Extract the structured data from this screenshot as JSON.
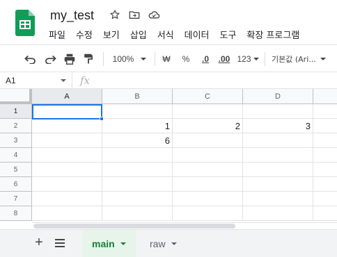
{
  "document": {
    "title": "my_test"
  },
  "menu": [
    "파일",
    "수정",
    "보기",
    "삽입",
    "서식",
    "데이터",
    "도구",
    "확장 프로그램"
  ],
  "toolbar": {
    "zoom": "100%",
    "currency": "₩",
    "percent": "%",
    "decrease_decimal": ".0",
    "increase_decimal": ".00",
    "number_format": "123",
    "font": "기본값 (Ari..."
  },
  "formula_bar": {
    "cell_ref": "A1",
    "fx": "fx"
  },
  "grid": {
    "columns": [
      "A",
      "B",
      "C",
      "D"
    ],
    "rows": [
      "1",
      "2",
      "3",
      "4",
      "5",
      "6",
      "7",
      "8"
    ],
    "cells": {
      "B2": "1",
      "C2": "2",
      "D2": "3",
      "B3": "6"
    }
  },
  "sheets": [
    {
      "label": "main",
      "active": true
    },
    {
      "label": "raw",
      "active": false
    }
  ],
  "colors": {
    "accent": "#1a73e8",
    "active_tab_bg": "#e6f4ea",
    "active_tab_text": "#188038",
    "logo": "#0f9d58"
  }
}
